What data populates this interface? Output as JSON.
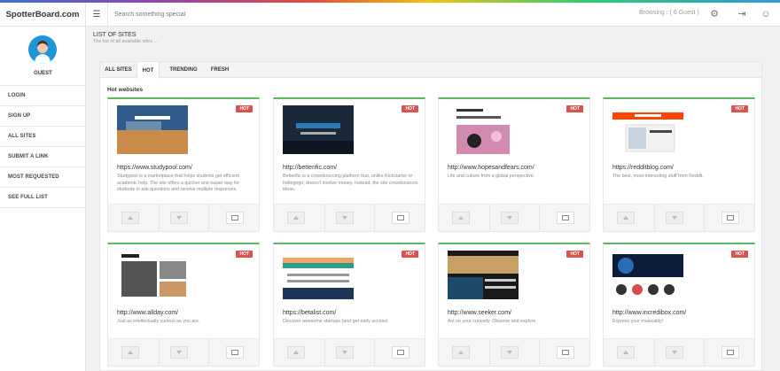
{
  "app": {
    "brand": "SpotterBoard.com"
  },
  "topbar": {
    "menu_icon": "menu-icon",
    "search_placeholder": "Search something special",
    "browsing": "Browsing : ( 6 Guest )"
  },
  "sidebar": {
    "user": "GUEST",
    "items": [
      "LOGIN",
      "SIGN UP",
      "ALL SITES",
      "SUBMIT A LINK",
      "MOST REQUESTED",
      "SEE FULL LIST"
    ]
  },
  "header": {
    "title": "LIST OF SITES",
    "subtitle": "The list of all available sites ..."
  },
  "tabs": [
    "ALL SITES",
    "HOT",
    "TRENDING",
    "FRESH"
  ],
  "active_tab": "HOT",
  "section_title": "Hot websites",
  "hot_label": "HOT",
  "cards": [
    {
      "url": "https://www.studypool.com/",
      "desc": "Studypool is a marketplace that helps students get efficient academic help. The site offers a quicker and easier way for students to ask questions and receive multiple responses."
    },
    {
      "url": "http://betterific.com/",
      "desc": "Betterific is a crowdsourcing platform that, unlike Kickstarter or Indiegogo, doesn't involve money. Instead, the site crowdsources ideas."
    },
    {
      "url": "http://www.hopesandfears.com/",
      "desc": "Life and culture from a global perspective."
    },
    {
      "url": "https://redditblog.com/",
      "desc": "The best, most-interesting stuff from Reddit."
    },
    {
      "url": "http://www.allday.com/",
      "desc": "Just as intellectually curious as you are."
    },
    {
      "url": "https://betalist.com/",
      "desc": "Discover awesome startups (and get early access)"
    },
    {
      "url": "http://www.seeker.com/",
      "desc": "Act on your curiosity. Observe and explore."
    },
    {
      "url": "http://www.incredibox.com/",
      "desc": "Express your musicality!"
    }
  ],
  "colors": {
    "accent_green": "#5cb85c",
    "hot_red": "#d9534f",
    "avatar_blue": "#1e96d8"
  }
}
